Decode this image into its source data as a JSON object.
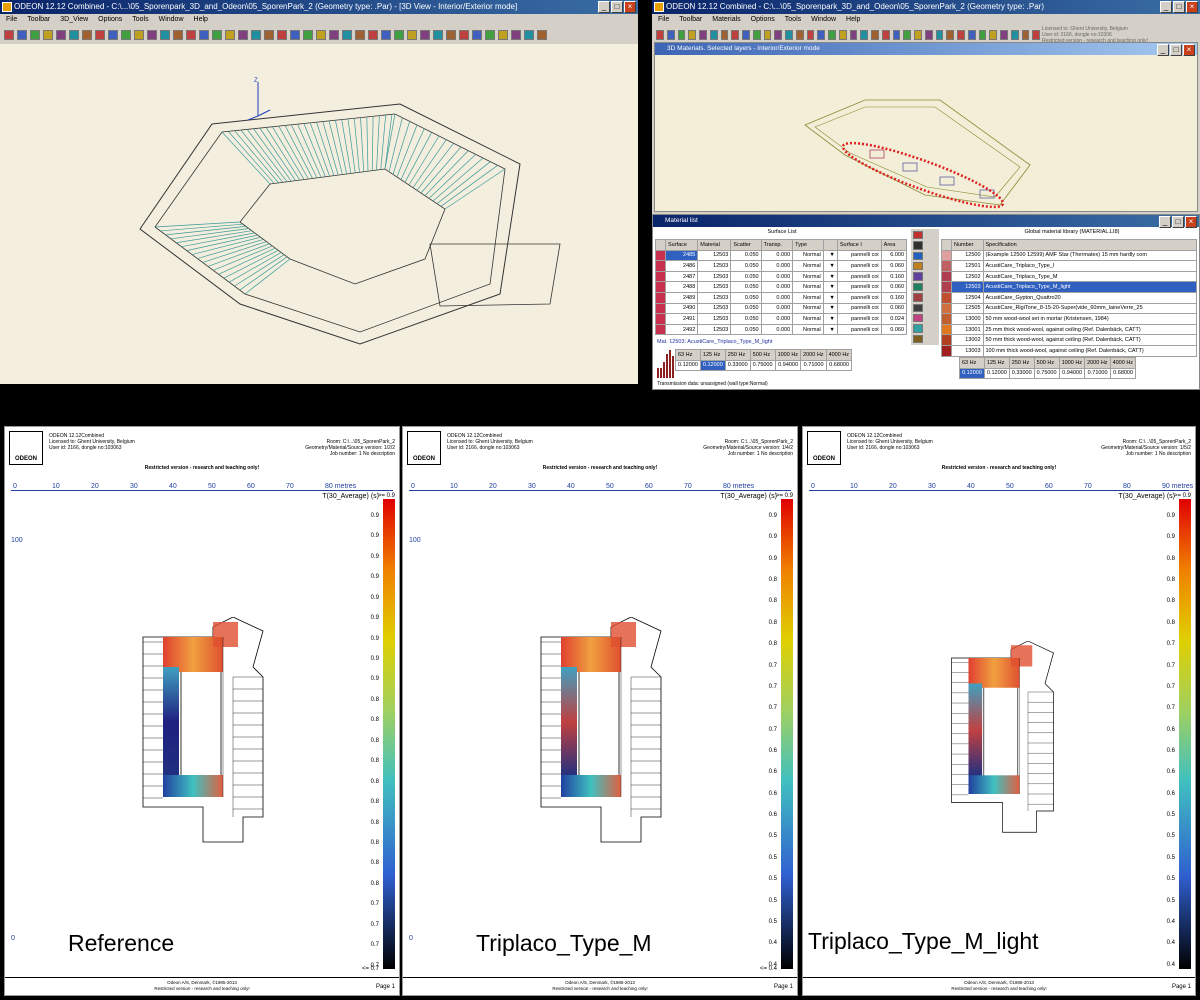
{
  "win3d": {
    "title": "ODEON 12.12 Combined  -  C:\\...\\05_Sporenpark_3D_and_Odeon\\05_SporenPark_2       (Geometry type: .Par) - [3D View - Interior/Exterior mode]",
    "menus": [
      "File",
      "Toolbar",
      "3D_View",
      "Options",
      "Tools",
      "Window",
      "Help"
    ],
    "axis_label": "Z"
  },
  "winMat": {
    "title": "ODEON 12.12 Combined  -  C:\\...\\05_Sporenpark_3D_and_Odeon\\05_SporenPark_2       (Geometry type: .Par)",
    "menus": [
      "File",
      "Toolbar",
      "Materials",
      "Options",
      "Tools",
      "Window",
      "Help"
    ],
    "license": [
      "Licensed to: Ghent University, Belgium",
      "User id: 2166, dongle no:10306",
      "Restricted version - research and teaching only!"
    ],
    "sub3d_title": "3D Materials. Selected layers - Interior/Exterior mode",
    "matlist_title": "Material list",
    "surface_list_label": "Surface List",
    "surface_headers": [
      "Surface",
      "Material",
      "Scatter",
      "Transp.",
      "Type",
      "",
      "Surface I",
      "Area"
    ],
    "surface_rows": [
      [
        "2485",
        "12503",
        "0.050",
        "0.000",
        "Normal",
        "▼",
        "pannelli coi",
        "6.000"
      ],
      [
        "2486",
        "12503",
        "0.050",
        "0.000",
        "Normal",
        "▼",
        "pannelli coi",
        "0.060"
      ],
      [
        "2487",
        "12503",
        "0.050",
        "0.000",
        "Normal",
        "▼",
        "pannelli coi",
        "0.160"
      ],
      [
        "2488",
        "12503",
        "0.050",
        "0.000",
        "Normal",
        "▼",
        "pannelli coi",
        "0.060"
      ],
      [
        "2489",
        "12503",
        "0.050",
        "0.000",
        "Normal",
        "▼",
        "pannelli coi",
        "0.160"
      ],
      [
        "2490",
        "12503",
        "0.050",
        "0.000",
        "Normal",
        "▼",
        "pannelli coi",
        "0.060"
      ],
      [
        "2491",
        "12503",
        "0.050",
        "0.000",
        "Normal",
        "▼",
        "pannelli coi",
        "0.024"
      ],
      [
        "2492",
        "12503",
        "0.050",
        "0.000",
        "Normal",
        "▼",
        "pannelli coi",
        "0.060"
      ]
    ],
    "mat_label": "Mat. 12503: AcustiCare_Triplaco_Type_M_light",
    "freq_headers": [
      "63 Hz",
      "125 Hz",
      "250 Hz",
      "500 Hz",
      "1000 Hz",
      "2000 Hz",
      "4000 Hz"
    ],
    "freq_values": [
      "0.12000",
      "0.12000",
      "0.33000",
      "0.75000",
      "0.94000",
      "0.71000",
      "0.68000"
    ],
    "transmission": "Transmission data: unassigned (wall type:Normal)",
    "library_label": "Global material library (MATERIAL.LI8)",
    "library_headers": [
      "Number",
      "Specification"
    ],
    "library_rows": [
      [
        "12500",
        "(Example 12500 12599) AMF Star (Thermatex) 15 mm hardly com"
      ],
      [
        "12501",
        "AcustiCare_Triplaco_Type_I"
      ],
      [
        "12502",
        "AcustiCare_Triplaco_Type_M"
      ],
      [
        "12503",
        "AcustiCare_Triplaco_Type_M_light"
      ],
      [
        "12504",
        "AcustiCare_Gypton_Quattro20"
      ],
      [
        "12505",
        "AcustiCare_RigiTone_8-15-20-Super(vide_60mm_laineVerre_25"
      ],
      [
        "13000",
        "50 mm wood-wool set in mortar (Kristensen, 1984)"
      ],
      [
        "13001",
        "25 mm thick wood-wool, against ceiling (Ref. Dalenbäck, CATT)"
      ],
      [
        "13002",
        "50 mm thick wood-wool, against ceiling (Ref. Dalenbäck, CATT)"
      ],
      [
        "13003",
        "100 mm thick wood-wool, against ceiling (Ref. Dalenbäck, CATT)"
      ]
    ],
    "lib_freq_values": [
      "0.12000",
      "0.12000",
      "0.33000",
      "0.75000",
      "0.94000",
      "0.71000",
      "0.68000"
    ],
    "lib_freq_headers": [
      "63 Hz",
      "125 Hz",
      "250 Hz",
      "500 Hz",
      "1000 Hz",
      "2000 Hz",
      "4000 Hz"
    ]
  },
  "reports": [
    {
      "app": "ODEON 12.12Combined",
      "licensed": "Licensed to: Ghent University, Belgium",
      "user": "User id: 2166, dongle no:103063",
      "room": "Room: C:\\...\\05_SporenPark_2",
      "geom": "Geometry/Material/Source version: 1/2/2",
      "job": "Job number: 1  No description",
      "restricted": "Restricted version - research and teaching only!",
      "ruler": [
        "0",
        "10",
        "20",
        "30",
        "40",
        "50",
        "60",
        "70",
        "80 metres"
      ],
      "param": "T(30_Average) (s)",
      "top": ">= 0.9",
      "scale": [
        "0.9",
        "0.9",
        "0.9",
        "0.9",
        "0.9",
        "0.9",
        "0.9",
        "0.9",
        "0.9",
        "0.8",
        "0.8",
        "0.8",
        "0.8",
        "0.8",
        "0.8",
        "0.8",
        "0.8",
        "0.8",
        "0.8",
        "0.7",
        "0.7",
        "0.7",
        "0.7"
      ],
      "bottom": "<= 0.7",
      "y100": "100",
      "y0": "0",
      "foot1": "Odeon A/S, Denmark, ©1985-2013",
      "foot2": "Restricted version - research and teaching only!",
      "page": "Page 1",
      "caption": "Reference"
    },
    {
      "app": "ODEON 12.12Combined",
      "licensed": "Licensed to: Ghent University, Belgium",
      "user": "User id: 2166, dongle no:103063",
      "room": "Room: C:\\...\\05_SporenPark_2",
      "geom": "Geometry/Material/Source version: 1/4/2",
      "job": "Job number: 1  No description",
      "restricted": "Restricted version - research and teaching only!",
      "ruler": [
        "0",
        "10",
        "20",
        "30",
        "40",
        "50",
        "60",
        "70",
        "80 metres"
      ],
      "param": "T(30_Average) (s)",
      "top": ">= 0.9",
      "scale": [
        "0.9",
        "0.9",
        "0.9",
        "0.8",
        "0.8",
        "0.8",
        "0.8",
        "0.7",
        "0.7",
        "0.7",
        "0.7",
        "0.6",
        "0.6",
        "0.6",
        "0.6",
        "0.5",
        "0.5",
        "0.5",
        "0.5",
        "0.5",
        "0.4",
        "0.4"
      ],
      "bottom": "<= 0.4",
      "y100": "100",
      "y0": "0",
      "foot1": "Odeon A/S, Denmark, ©1985-2013",
      "foot2": "Restricted version - research and teaching only!",
      "page": "Page 1",
      "caption": "Triplaco_Type_M"
    },
    {
      "app": "ODEON 12.12Combined",
      "licensed": "Licensed to: Ghent University, Belgium",
      "user": "User id: 2166, dongle no:103063",
      "room": "Room: C:\\...\\05_SporenPark_2",
      "geom": "Geometry/Material/Source version: 1/5/2",
      "job": "Job number: 1  No description",
      "restricted": "Restricted version - research and teaching only!",
      "ruler": [
        "0",
        "10",
        "20",
        "30",
        "40",
        "50",
        "60",
        "70",
        "80",
        "90 metres"
      ],
      "param": "T(30_Average) (s)",
      "top": ">= 0.9",
      "scale": [
        "0.9",
        "0.9",
        "0.8",
        "0.8",
        "0.8",
        "0.8",
        "0.7",
        "0.7",
        "0.7",
        "0.7",
        "0.6",
        "0.6",
        "0.6",
        "0.6",
        "0.5",
        "0.5",
        "0.5",
        "0.5",
        "0.5",
        "0.4",
        "0.4",
        "0.4"
      ],
      "bottom": "",
      "y100": "",
      "y0": "",
      "foot1": "Odeon A/S, Denmark, ©1985-2013",
      "foot2": "Restricted version - research and teaching only!",
      "page": "Page 1",
      "caption": "Triplaco_Type_M_light"
    }
  ]
}
